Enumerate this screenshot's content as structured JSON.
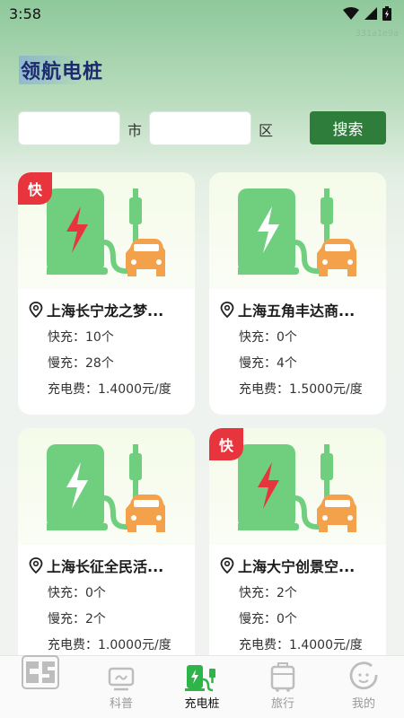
{
  "status_bar": {
    "time": "3:58"
  },
  "build_id": "331a1e9a",
  "app": {
    "title": "领航电桩"
  },
  "search": {
    "city_placeholder": "",
    "city_unit": "市",
    "district_placeholder": "",
    "district_unit": "区",
    "button_label": "搜索"
  },
  "labels": {
    "fast_tag": "快"
  },
  "stations": [
    {
      "name": "上海长宁龙之梦...",
      "fast": "快充：10个",
      "slow": "慢充：28个",
      "fee": "充电费：1.4000元/度",
      "is_fast": true
    },
    {
      "name": "上海五角丰达商...",
      "fast": "快充：0个",
      "slow": "慢充：4个",
      "fee": "充电费：1.5000元/度",
      "is_fast": false
    },
    {
      "name": "上海长征全民活...",
      "fast": "快充：0个",
      "slow": "慢充：2个",
      "fee": "充电费：1.0000元/度",
      "is_fast": false
    },
    {
      "name": "上海大宁创景空...",
      "fast": "快充：2个",
      "slow": "慢充：0个",
      "fee": "充电费：1.4000元/度",
      "is_fast": true
    }
  ],
  "tabs": [
    {
      "label": "",
      "icon": "app-logo-icon"
    },
    {
      "label": "科普",
      "icon": "science-icon"
    },
    {
      "label": "充电桩",
      "icon": "charging-pile-icon",
      "active": true
    },
    {
      "label": "旅行",
      "icon": "luggage-icon"
    },
    {
      "label": "我的",
      "icon": "profile-icon"
    }
  ],
  "colors": {
    "accent": "#2f7d3b",
    "fast_tag": "#e8343c",
    "pile_green": "#6fcf7e",
    "car_orange": "#f3a24b"
  }
}
